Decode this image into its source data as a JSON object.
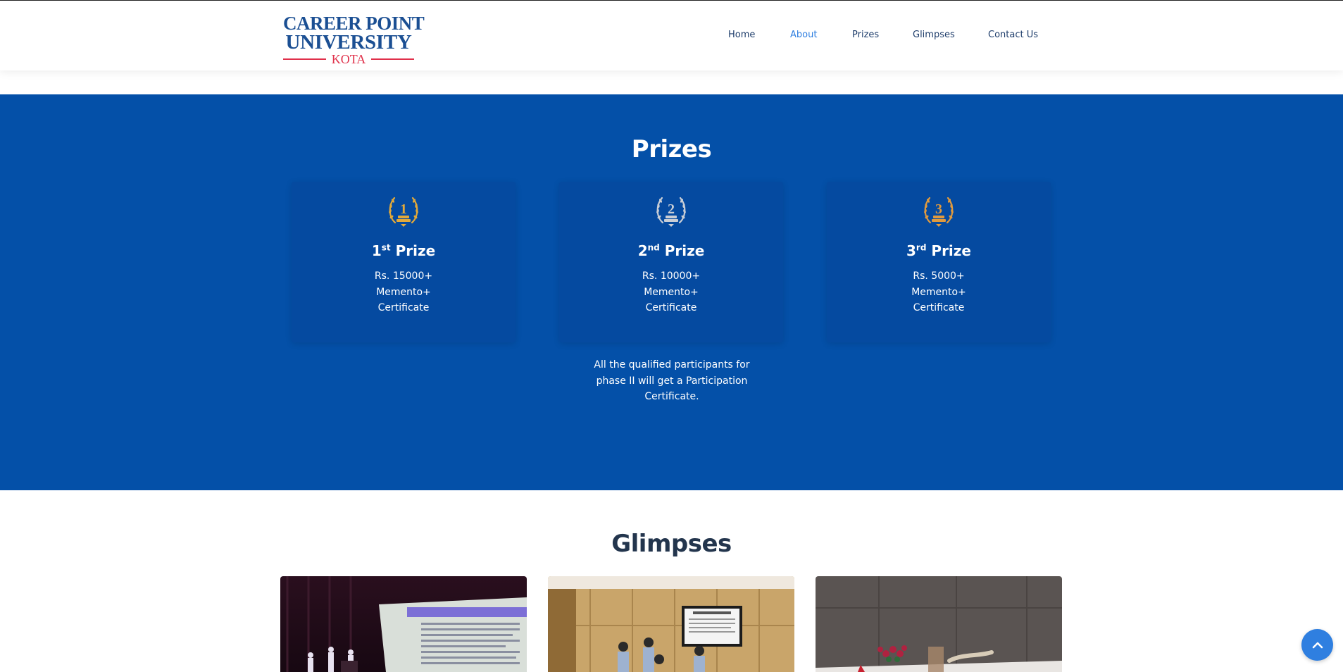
{
  "brand": {
    "line1": "CAREER POINT",
    "line2": "UNIVERSITY",
    "line3": "KOTA"
  },
  "nav": [
    {
      "label": "Home",
      "active": false
    },
    {
      "label": "About",
      "active": true
    },
    {
      "label": "Prizes",
      "active": false
    },
    {
      "label": "Glimpses",
      "active": false
    },
    {
      "label": "Contact Us",
      "active": false
    }
  ],
  "prizes": {
    "heading": "Prizes",
    "cards": [
      {
        "rank": "1",
        "suffix": "st",
        "word": "Prize",
        "medal_number": "1",
        "line1": "Rs. 15000+",
        "line2": "Memento+",
        "line3": "Certificate",
        "medal_icon": "gold-laurel-medal-icon",
        "medal_color": "#e2a93a"
      },
      {
        "rank": "2",
        "suffix": "nd",
        "word": "Prize",
        "medal_number": "2",
        "line1": "Rs. 10000+",
        "line2": "Memento+",
        "line3": "Certificate",
        "medal_icon": "silver-laurel-medal-icon",
        "medal_color": "#c9ced6"
      },
      {
        "rank": "3",
        "suffix": "rd",
        "word": "Prize",
        "medal_number": "3",
        "line1": "Rs. 5000+",
        "line2": "Memento+",
        "line3": "Certificate",
        "medal_icon": "bronze-laurel-medal-icon",
        "medal_color": "#e09a3e"
      }
    ],
    "note": "All the qualified participants for phase II will get a Participation Certificate."
  },
  "glimpses": {
    "heading": "Glimpses"
  },
  "colors": {
    "brand_blue": "#1b4f93",
    "accent_red": "#e0304a",
    "section_blue": "#0450a8",
    "link_active": "#2f7fe0",
    "nav_text": "#1e3d6b"
  },
  "scroll_top": {
    "icon": "chevron-up-icon"
  }
}
